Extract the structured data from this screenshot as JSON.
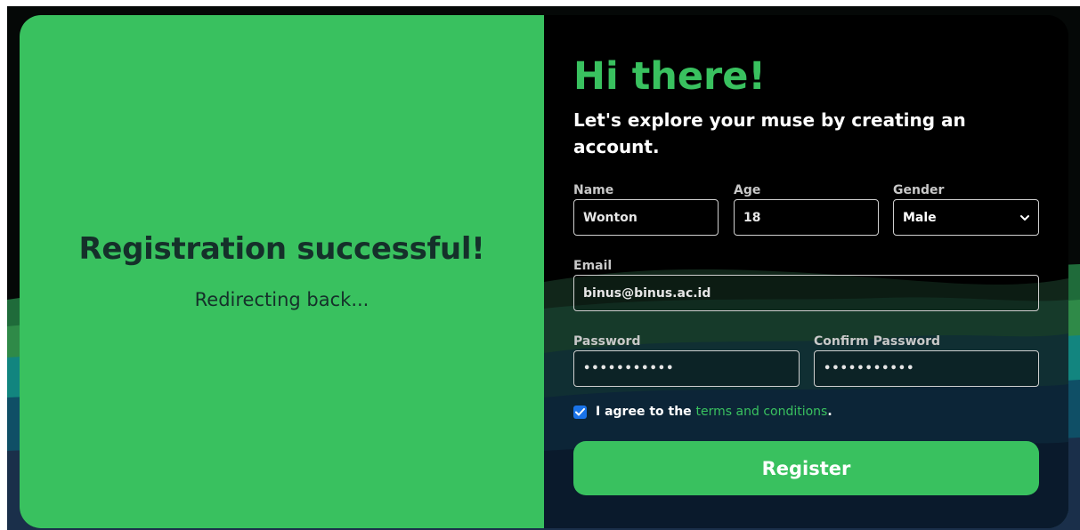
{
  "left": {
    "title": "Registration successful!",
    "subtitle": "Redirecting back..."
  },
  "form": {
    "heading": "Hi there!",
    "tagline": "Let's explore your muse by creating an account.",
    "name": {
      "label": "Name",
      "value": "Wonton"
    },
    "age": {
      "label": "Age",
      "value": "18"
    },
    "gender": {
      "label": "Gender",
      "selected": "Male"
    },
    "email": {
      "label": "Email",
      "value": "binus@binus.ac.id"
    },
    "password": {
      "label": "Password",
      "masked": "•••••••••••"
    },
    "confirm_password": {
      "label": "Confirm Password",
      "masked": "•••••••••••"
    },
    "agree": {
      "checked": true,
      "prefix": "I agree to the ",
      "link": "terms and conditions",
      "suffix": "."
    },
    "register_label": "Register"
  },
  "icons": {
    "chevron": "chevron-down-icon",
    "check": "checkmark-icon"
  },
  "colors": {
    "brand_green": "#39c15f",
    "text_dark": "#15302a",
    "panel_black": "#000000",
    "checkbox_blue": "#1a73e8"
  }
}
